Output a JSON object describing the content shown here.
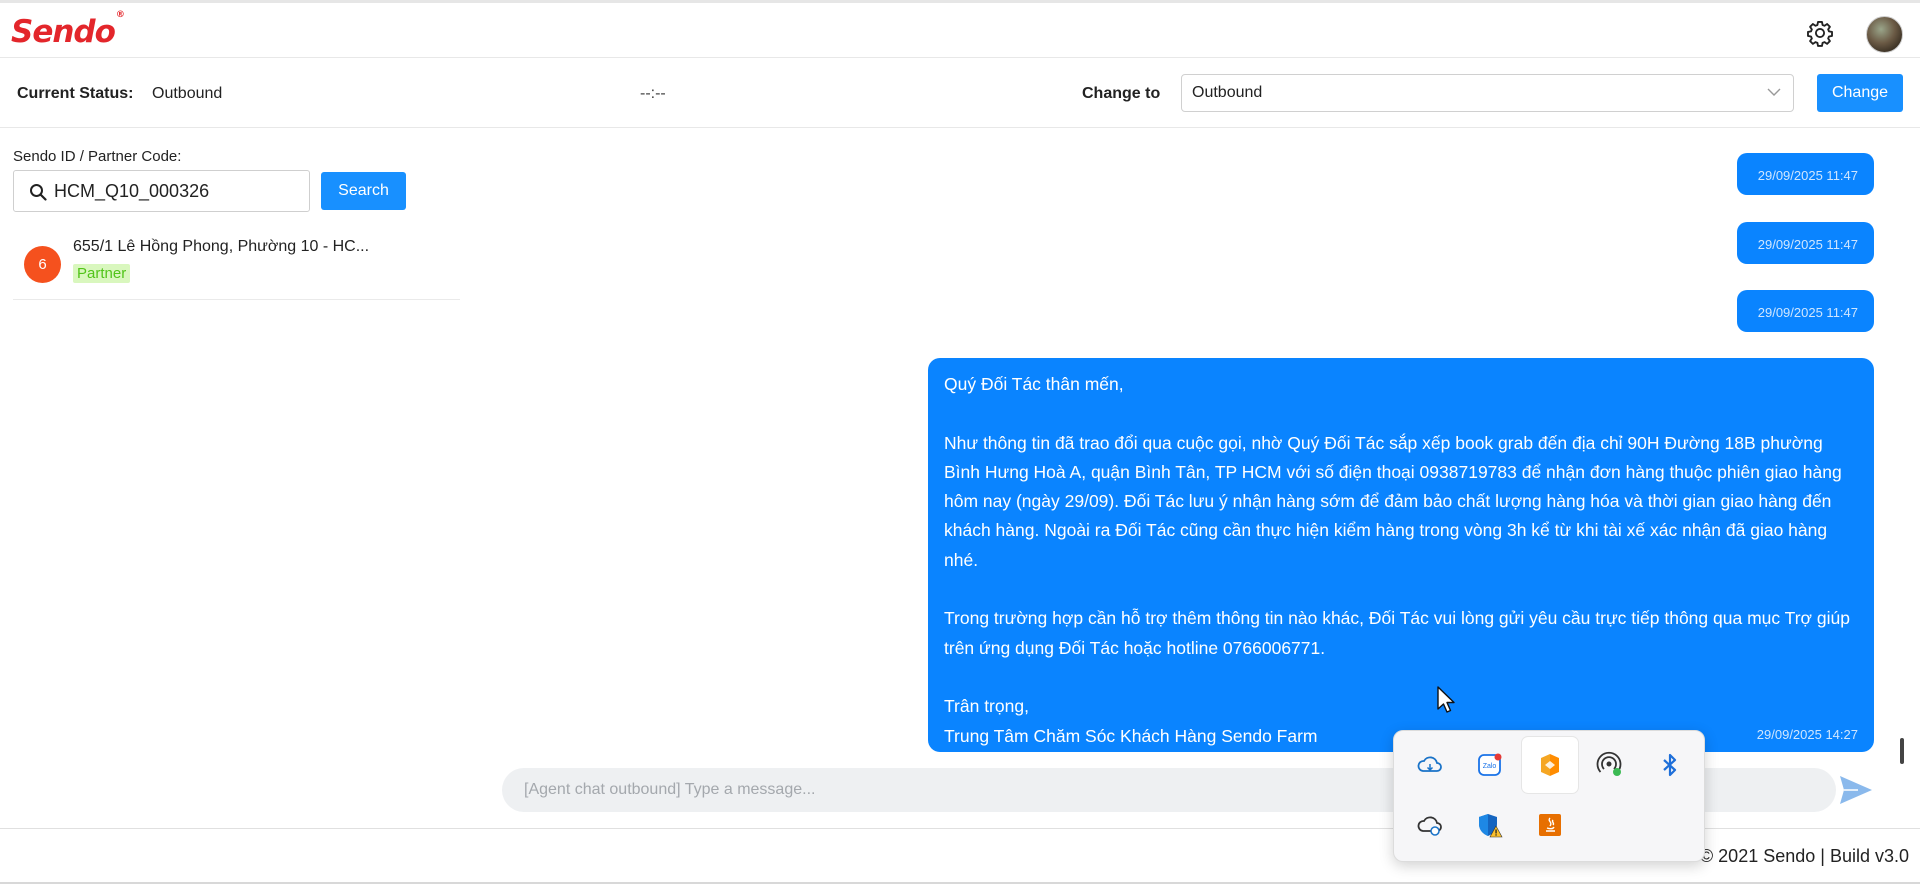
{
  "header": {
    "logo": "Sendo",
    "logo_mark": "®",
    "settings_icon": "gear-icon",
    "avatar_icon": "user-avatar"
  },
  "status_bar": {
    "current_status_label": "Current Status:",
    "current_status_value": "Outbound",
    "timer": "--:--",
    "change_to_label": "Change to",
    "change_to_value": "Outbound",
    "change_button": "Change"
  },
  "search": {
    "label": "Sendo ID / Partner Code:",
    "value": "HCM_Q10_000326",
    "button": "Search"
  },
  "partner_list": [
    {
      "badge": "6",
      "address": "655/1 Lê Hồng Phong, Phường 10 - HC...",
      "tag": "Partner"
    }
  ],
  "messages": [
    {
      "timestamp": "29/09/2025 11:47"
    },
    {
      "timestamp": "29/09/2025 11:47"
    },
    {
      "timestamp": "29/09/2025 11:47"
    },
    {
      "lines": [
        "Quý Đối Tác thân mến,",
        "",
        "Như thông tin đã trao đổi qua cuộc gọi, nhờ Quý Đối Tác sắp xếp book grab đến địa chỉ 90H Đường 18B phường Bình Hưng Hoà A, quận Bình Tân, TP HCM với số điện thoại 0938719783 để nhận đơn hàng thuộc phiên giao hàng hôm nay (ngày 29/09). Đối Tác lưu ý nhận hàng sớm để đảm bảo chất lượng hàng hóa và thời gian giao hàng đến khách hàng. Ngoài ra Đối Tác cũng cần thực hiện kiểm hàng trong vòng 3h kể từ khi tài xế xác nhận đã giao hàng nhé.",
        "",
        "Trong trường hợp cần hỗ trợ thêm thông tin nào khác, Đối Tác vui lòng gửi yêu cầu trực tiếp thông qua mục Trợ giúp trên ứng dụng Đối Tác hoặc hotline 0766006771.",
        "",
        "Trân trọng,",
        "Trung Tâm Chăm Sóc Khách Hàng Sendo Farm"
      ],
      "timestamp": "29/09/2025 14:27"
    }
  ],
  "chat_input": {
    "placeholder": "[Agent chat outbound] Type a message..."
  },
  "footer": {
    "text": "© 2021 Sendo | Build v3.0"
  },
  "tray_icons": [
    "onedrive-cloud-icon",
    "zalo-icon",
    "app-orange-icon",
    "hotspot-icon",
    "bluetooth-icon",
    "cloud-sync-icon",
    "security-warning-icon",
    "java-icon"
  ],
  "colors": {
    "brand": "#e3262b",
    "primary": "#1890ff",
    "bubble": "#0a84ff",
    "badge": "#f5511e"
  }
}
